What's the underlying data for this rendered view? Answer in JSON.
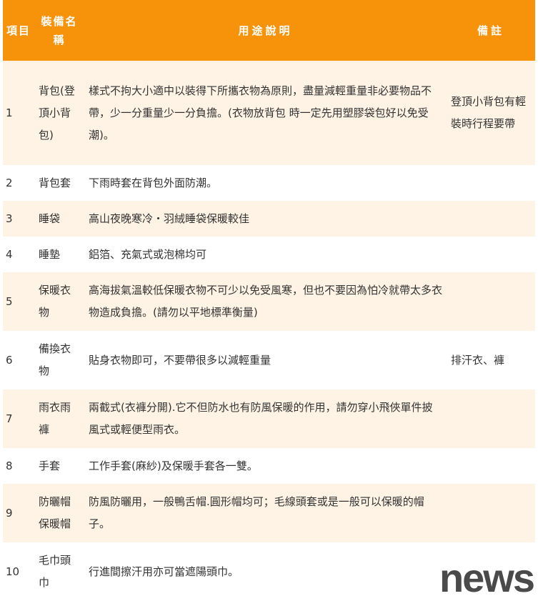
{
  "colors": {
    "header_bg": "#f7920b",
    "odd_row_bg": "#fef3e4",
    "even_row_bg": "#ffffff",
    "text": "#333333"
  },
  "table": {
    "headers": {
      "index": "項目",
      "name": "裝備名稱",
      "description": "用途說明",
      "note": "備註"
    },
    "rows": [
      {
        "index": "1",
        "name": "背包(登頂小背包)",
        "description": "樣式不拘大小適中以裝得下所攜衣物為原則，盡量減輕重量非必要物品不帶，少一分重量少一分負擔。(衣物放背包 時一定先用塑膠袋包好以免受潮)。",
        "note": "登頂小背包有輕裝時行程要帶"
      },
      {
        "index": "2",
        "name": "背包套",
        "description": "下雨時套在背包外面防潮。",
        "note": ""
      },
      {
        "index": "3",
        "name": "睡袋",
        "description": "高山夜晚寒冷・羽絨睡袋保暖較佳",
        "note": ""
      },
      {
        "index": "4",
        "name": "睡墊",
        "description": "鋁箔、充氣式或泡棉均可",
        "note": ""
      },
      {
        "index": "5",
        "name": "保暖衣物",
        "description": "高海拔氣溫較低保暖衣物不可少以免受風寒，但也不要因為怕冷就帶太多衣物造成負擔。(請勿以平地標準衡量)",
        "note": ""
      },
      {
        "index": "6",
        "name": "備換衣物",
        "description": "貼身衣物即可，不要帶很多以減輕重量",
        "note": "排汗衣、褲"
      },
      {
        "index": "7",
        "name": "雨衣雨褲",
        "description": "兩截式(衣褲分開).它不但防水也有防風保暖的作用，請勿穿小飛俠單件披風式或輕便型雨衣。",
        "note": ""
      },
      {
        "index": "8",
        "name": "手套",
        "description": "工作手套(麻紗)及保暖手套各一雙。",
        "note": ""
      },
      {
        "index": "9",
        "name": "防曬帽保暖帽",
        "description": "防風防曬用，一般鴨舌帽.圓形帽均可；毛線頭套或是一般可以保暖的帽子。",
        "note": ""
      },
      {
        "index": "10",
        "name": "毛巾頭巾",
        "description": "行進間擦汗用亦可當遮陽頭巾。",
        "note": ""
      }
    ]
  },
  "watermark": "news"
}
